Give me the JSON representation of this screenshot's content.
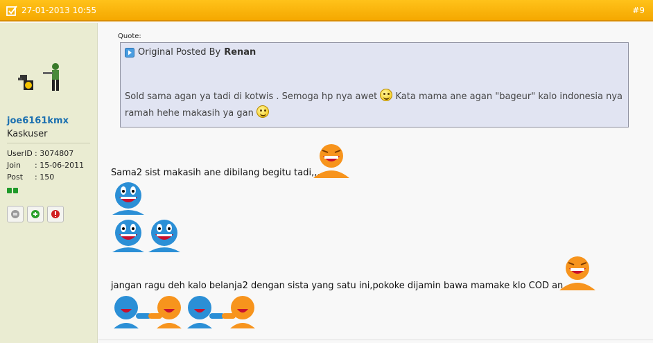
{
  "post": {
    "date": "27-01-2013 10:55",
    "number": "#9"
  },
  "user": {
    "name": "joe6161kmx",
    "title": "Kaskuser",
    "info": [
      {
        "label": "UserID",
        "value": ": 3074807"
      },
      {
        "label": "Join",
        "value": ": 15-06-2011"
      },
      {
        "label": "Post",
        "value": ": 150"
      }
    ]
  },
  "quote": {
    "label": "Quote:",
    "prefix": "Original Posted By",
    "author": "Renan",
    "line1": "Sold sama agan ya tadi di kotwis . Semoga hp nya awet",
    "line1b": "Kata mama ane agan \"bageur\" kalo indonesia nya",
    "line2": "ramah hehe makasih ya gan"
  },
  "messages": {
    "m1": "Sama2 sist makasih ane dibilang begitu tadi,,,",
    "m2": "jangan ragu deh kalo belanja2 dengan sista yang satu ini,pokoke dijamin bawa mamake klo COD an...."
  },
  "icons": {
    "header": "checkbox-icon",
    "reputation": "reputation-icon",
    "buttons": [
      "profile-icon",
      "add-rep-icon",
      "report-icon"
    ]
  },
  "colors": {
    "header": "#f5a800",
    "username": "#1a6fb0",
    "quote_bg": "#e1e4f2"
  }
}
